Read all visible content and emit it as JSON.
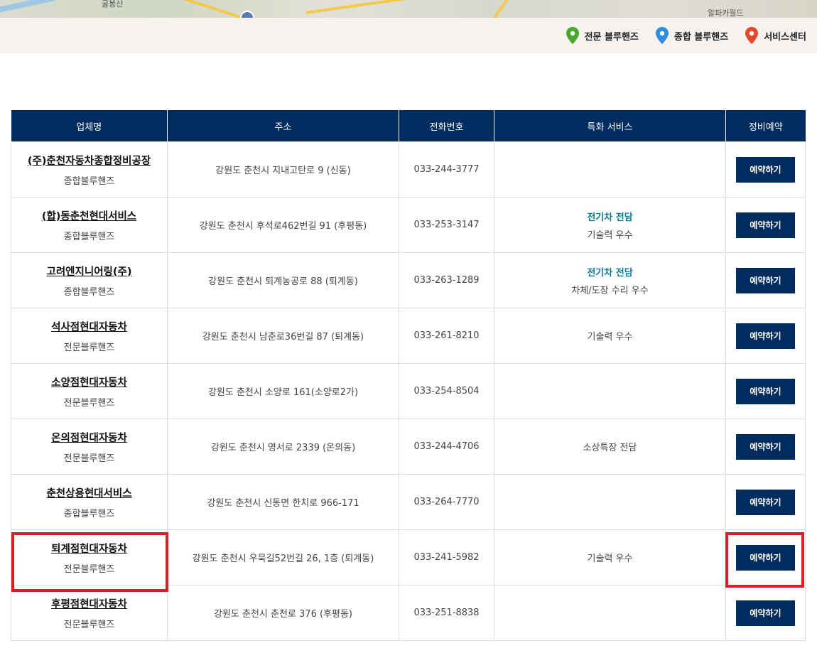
{
  "map": {
    "labels": [
      "굴봉산",
      "알파카월드"
    ]
  },
  "legend": {
    "items": [
      {
        "label": "전문 블루핸즈",
        "color": "#4aa52e",
        "icon": "map-pin-green"
      },
      {
        "label": "종합 블루핸즈",
        "color": "#2f8ce0",
        "icon": "map-pin-blue"
      },
      {
        "label": "서비스센터",
        "color": "#e24a2a",
        "icon": "map-pin-red"
      }
    ]
  },
  "table": {
    "headers": [
      "업체명",
      "주소",
      "전화번호",
      "특화 서비스",
      "정비예약"
    ],
    "rows": [
      {
        "name": "(주)춘천자동차종합정비공장",
        "type": "종합블루핸즈",
        "address": "강원도 춘천시 지내고탄로 9 (신동)",
        "phone": "033-244-3777",
        "ev": "",
        "service": "",
        "button": "예약하기"
      },
      {
        "name": "(합)동춘천현대서비스",
        "type": "종합블루핸즈",
        "address": "강원도 춘천시 후석로462번길 91 (후평동)",
        "phone": "033-253-3147",
        "ev": "전기차 전담",
        "service": "기술력 우수",
        "button": "예약하기"
      },
      {
        "name": "고려엔지니어링(주)",
        "type": "종합블루핸즈",
        "address": "강원도 춘천시 퇴계농공로 88 (퇴계동)",
        "phone": "033-263-1289",
        "ev": "전기차 전담",
        "service": "차체/도장 수리 우수",
        "button": "예약하기"
      },
      {
        "name": "석사점현대자동차",
        "type": "전문블루핸즈",
        "address": "강원도 춘천시 남춘로36번길 87 (퇴계동)",
        "phone": "033-261-8210",
        "ev": "",
        "service": "기술력 우수",
        "button": "예약하기"
      },
      {
        "name": "소양점현대자동차",
        "type": "전문블루핸즈",
        "address": "강원도 춘천시 소양로 161(소양로2가)",
        "phone": "033-254-8504",
        "ev": "",
        "service": "",
        "button": "예약하기"
      },
      {
        "name": "온의점현대자동차",
        "type": "전문블루핸즈",
        "address": "강원도 춘천시 영서로 2339 (온의동)",
        "phone": "033-244-4706",
        "ev": "",
        "service": "소상특장 전담",
        "button": "예약하기"
      },
      {
        "name": "춘천상용현대서비스",
        "type": "종합블루핸즈",
        "address": "강원도 춘천시 신동면 한치로 966-171",
        "phone": "033-264-7770",
        "ev": "",
        "service": "",
        "button": "예약하기"
      },
      {
        "name": "퇴계점현대자동차",
        "type": "전문블루핸즈",
        "address": "강원도 춘천시 우묵길52번길 26, 1층 (퇴계동)",
        "phone": "033-241-5982",
        "ev": "",
        "service": "기술력 우수",
        "button": "예약하기"
      },
      {
        "name": "후평점현대자동차",
        "type": "전문블루핸즈",
        "address": "강원도 춘천시 춘천로 376 (후평동)",
        "phone": "033-251-8838",
        "ev": "",
        "service": "",
        "button": "예약하기"
      }
    ]
  },
  "highlight": {
    "row_index": 7,
    "color": "#e21b24"
  }
}
